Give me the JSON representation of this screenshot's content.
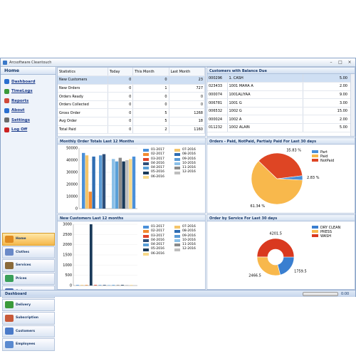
{
  "window": {
    "title": "Arcsoftware Cleantouch"
  },
  "sidebar": {
    "home": "Home",
    "links": [
      "Dashboard",
      "TimeLogs",
      "Reports",
      "About",
      "Settings",
      "Log Off"
    ],
    "link_colors": [
      "#2a6fd0",
      "#3a9a3a",
      "#d04a3a",
      "#2a6fd0",
      "#6a6a6a",
      "#cc2222"
    ],
    "modules": [
      "Home",
      "Clothes",
      "Services",
      "Prices",
      "Orders",
      "Delivery",
      "Subscription",
      "Customers",
      "Employees"
    ],
    "module_colors": [
      "#e08a20",
      "#6a8ac8",
      "#8a6a3a",
      "#3aa05a",
      "#4a6ab0",
      "#3a9a3a",
      "#c85a3a",
      "#4a7ac8",
      "#5a8ad0"
    ],
    "active_module": "Home"
  },
  "statistics": {
    "headers": [
      "Statistics",
      "Today",
      "This Month",
      "Last Month"
    ],
    "rows": [
      [
        "New Customers",
        "0",
        "0",
        "23"
      ],
      [
        "New Orders",
        "0",
        "1",
        "727"
      ],
      [
        "Orders Ready",
        "0",
        "0",
        "0"
      ],
      [
        "Orders Collected",
        "0",
        "0",
        "0"
      ],
      [
        "Gross Order",
        "0",
        "5",
        "1268"
      ],
      [
        "Avg Order",
        "0",
        "5",
        "18"
      ],
      [
        "Total Paid",
        "0",
        "2",
        "1160"
      ]
    ]
  },
  "balance": {
    "title": "Customers with Balance Due",
    "rows": [
      [
        "000296",
        "1. CASH",
        "5.00"
      ],
      [
        "023433",
        "1001 MAHA A",
        "2.00"
      ],
      [
        "000074",
        "1001ALIYAA",
        "9.00"
      ],
      [
        "006781",
        "1001 G",
        "3.00"
      ],
      [
        "006532",
        "1002 G",
        "15.00"
      ],
      [
        "000024",
        "1002 A",
        "2.00"
      ],
      [
        "011232",
        "1002 ALAIN",
        "5.00"
      ]
    ]
  },
  "panels": {
    "monthly_title": "Monthly Order Totals Last 12 Months",
    "paid_title": "Orders - Paid, NotPaid, Partialy Paid For Last 30 days",
    "newcust_title": "New Customers Last 12 months",
    "service_title": "Order by Service For Last 30 days"
  },
  "month_legend": {
    "labels": [
      "01-2017",
      "07-2016",
      "02-2017",
      "08-2016",
      "03-2017",
      "09-2016",
      "04-2016",
      "10-2016",
      "04-2017",
      "11-2016",
      "05-2016",
      "12-2016",
      "06-2016"
    ],
    "colors": [
      "#4a90d9",
      "#f4c56a",
      "#f28a30",
      "#2f6db3",
      "#e0442a",
      "#5b9bd5",
      "#2e4f7a",
      "#8cc0e8",
      "#5aa0d8",
      "#8a8a8a",
      "#1a3a5a",
      "#bdbdbd",
      "#f8d98a"
    ]
  },
  "newcust_legend": {
    "labels": [
      "01-2017",
      "07-2016",
      "02-2017",
      "08-2016",
      "03-2017",
      "09-2016",
      "04-2016",
      "10-2016",
      "04-2017",
      "11-2016",
      "05-2016",
      "12-2016",
      "06-2016"
    ]
  },
  "chart_data": [
    {
      "type": "bar",
      "title": "Monthly Order Totals Last 12 Months",
      "ylim": [
        0,
        50000
      ],
      "yticks": [
        "50000",
        "40000",
        "30000",
        "20000",
        "10000",
        "0"
      ],
      "categories": [
        "01-2017",
        "02-2017",
        "03-2017",
        "04-2016",
        "04-2017",
        "05-2016",
        "06-2016",
        "07-2016",
        "08-2016",
        "09-2016",
        "10-2016",
        "11-2016",
        "12-2016"
      ],
      "groups": [
        [
          46000,
          44000,
          14000,
          43000,
          0,
          44000,
          45000
        ],
        [
          41000,
          39000,
          42000,
          39000,
          40000,
          41000,
          43000
        ]
      ]
    },
    {
      "type": "pie",
      "title": "Orders - Paid, NotPaid, Partialy Paid For Last 30 days",
      "labels": [
        "Part",
        "Paid",
        "NotPaid"
      ],
      "values": [
        2.83,
        61.34,
        35.83
      ],
      "display": [
        "2.83 %",
        "61.34 %",
        "35.83 %"
      ],
      "colors": [
        "#4a8fd8",
        "#f8b84c",
        "#de4524"
      ]
    },
    {
      "type": "bar",
      "title": "New Customers Last 12 months",
      "ylim": [
        0,
        3000
      ],
      "yticks": [
        "3000",
        "2500",
        "2000",
        "1500",
        "1000",
        "500",
        "0"
      ],
      "values": [
        20,
        25,
        15,
        3000,
        30,
        25,
        20,
        25,
        30,
        20,
        25,
        20,
        20
      ]
    },
    {
      "type": "pie",
      "title": "Order by Service For Last 30 days",
      "labels": [
        "DRY CLEAN",
        "PRESS",
        "WASH"
      ],
      "values": [
        1759.5,
        2466.5,
        4201.5
      ],
      "display": [
        "1759.5",
        "2466.5",
        "4201.5"
      ],
      "colors": [
        "#3a7fd0",
        "#f8b84c",
        "#d9391f"
      ]
    }
  ],
  "status": {
    "label": "Dashboard",
    "time": "0:00"
  }
}
